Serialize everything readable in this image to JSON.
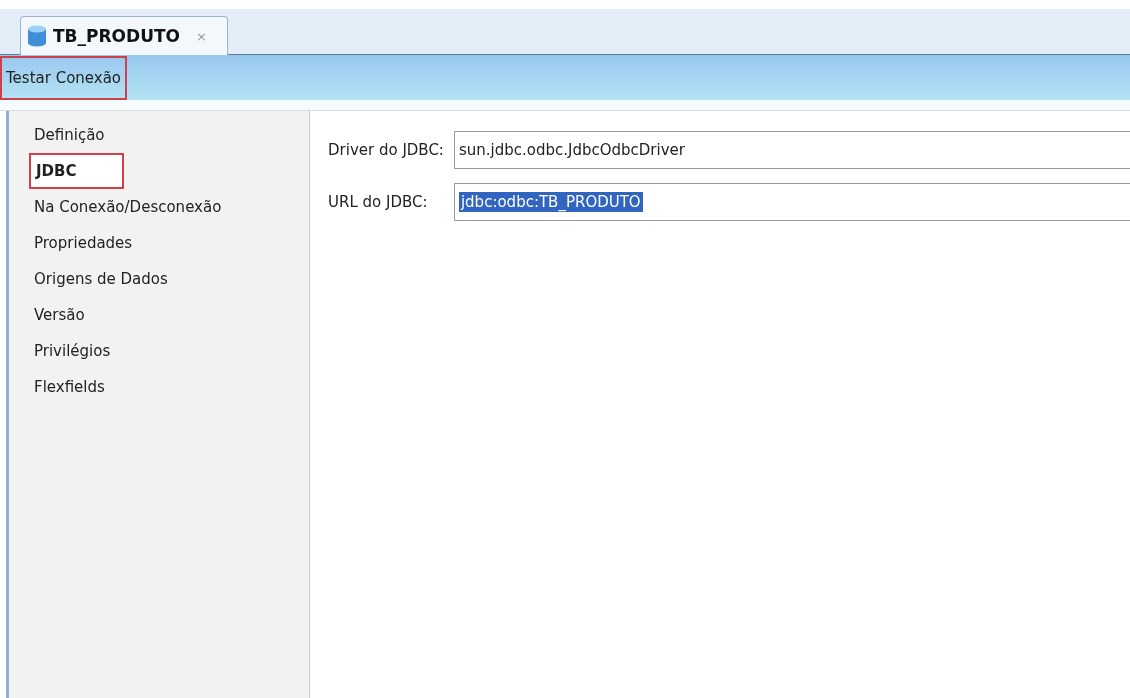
{
  "tabs": [
    {
      "label": "TB_PRODUTO",
      "close": "×",
      "selected": true
    }
  ],
  "toolbar": {
    "button": {
      "label": "Testar Conexão",
      "annotated": true
    }
  },
  "sidebar": {
    "items": [
      {
        "label": "Definição",
        "selected": false,
        "annotated": false
      },
      {
        "label": "JDBC",
        "selected": true,
        "annotated": true
      },
      {
        "label": "Na Conexão/Desconexão",
        "selected": false,
        "annotated": false
      },
      {
        "label": "Propriedades",
        "selected": false,
        "annotated": false
      },
      {
        "label": "Origens de Dados",
        "selected": false,
        "annotated": false
      },
      {
        "label": "Versão",
        "selected": false,
        "annotated": false
      },
      {
        "label": "Privilégios",
        "selected": false,
        "annotated": false
      },
      {
        "label": "Flexfields",
        "selected": false,
        "annotated": false
      }
    ]
  },
  "form": {
    "fields": [
      {
        "label": "Driver do JDBC:",
        "value": "sun.jdbc.odbc.JdbcOdbcDriver",
        "text_selected": false
      },
      {
        "label": "URL do JDBC:",
        "value": "jdbc:odbc:TB_PRODUTO",
        "text_selected": true
      }
    ]
  }
}
